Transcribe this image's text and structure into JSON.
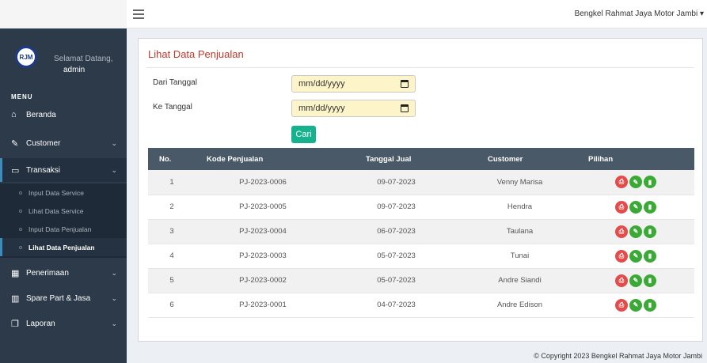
{
  "header": {
    "brand_user": "Bengkel Rahmat Jaya Motor Jambi"
  },
  "sidebar": {
    "welcome": "Selamat Datang,",
    "user": "admin",
    "menu_header": "MENU",
    "items": [
      {
        "label": "Beranda",
        "icon": "home-icon"
      },
      {
        "label": "Customer",
        "icon": "edit-icon"
      },
      {
        "label": "Transaksi",
        "icon": "monitor-icon"
      },
      {
        "label": "Penerimaan",
        "icon": "table-icon"
      },
      {
        "label": "Spare Part & Jasa",
        "icon": "bar-chart-icon"
      },
      {
        "label": "Laporan",
        "icon": "copy-icon"
      }
    ],
    "submenu": [
      {
        "label": "Input Data Service"
      },
      {
        "label": "Lihat Data Service"
      },
      {
        "label": "Input Data Penjualan"
      },
      {
        "label": "Lihat Data Penjualan"
      }
    ]
  },
  "main": {
    "title": "Lihat Data Penjualan",
    "from_label": "Dari Tanggal",
    "to_label": "Ke Tanggal",
    "date_placeholder": "mm/dd/yyyy",
    "search_button": "Cari",
    "columns": [
      "No.",
      "Kode Penjualan",
      "Tanggal Jual",
      "Customer",
      "Pilihan"
    ],
    "rows": [
      {
        "no": "1",
        "kode": "PJ-2023-0006",
        "tanggal": "09-07-2023",
        "customer": "Venny Marisa"
      },
      {
        "no": "2",
        "kode": "PJ-2023-0005",
        "tanggal": "09-07-2023",
        "customer": "Hendra"
      },
      {
        "no": "3",
        "kode": "PJ-2023-0004",
        "tanggal": "06-07-2023",
        "customer": "Taulana"
      },
      {
        "no": "4",
        "kode": "PJ-2023-0003",
        "tanggal": "05-07-2023",
        "customer": "Tunai"
      },
      {
        "no": "5",
        "kode": "PJ-2023-0002",
        "tanggal": "05-07-2023",
        "customer": "Andre Siandi"
      },
      {
        "no": "6",
        "kode": "PJ-2023-0001",
        "tanggal": "04-07-2023",
        "customer": "Andre Edison"
      }
    ]
  },
  "footer": {
    "copyright": "© Copyright 2023 Bengkel Rahmat Jaya Motor Jambi"
  },
  "colors": {
    "sidebar": "#2d3a49",
    "accent": "#3c8dbc",
    "title": "#c0392b",
    "button": "#16b28d",
    "print": "#e54b4b",
    "edit": "#3aa935"
  }
}
